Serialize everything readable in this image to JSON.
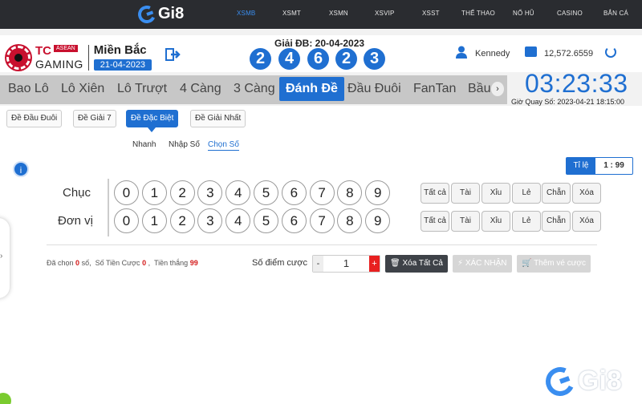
{
  "topnav": {
    "logo": "Gi8",
    "items": [
      "XSMB",
      "XSMT",
      "XSMN",
      "XSVIP",
      "XSST",
      "THỂ THAO",
      "NỔ HŨ",
      "CASINO",
      "BẮN CÁ"
    ],
    "active": "XSMB"
  },
  "header": {
    "brand_tc": "TC",
    "brand_asean": "ASEAN",
    "brand_gaming": "GAMING",
    "region": "Miền Bắc",
    "region_date": "21-04-2023",
    "special_label": "Giải ĐB: 20-04-2023",
    "special_numbers": [
      "2",
      "4",
      "6",
      "2",
      "3"
    ],
    "username": "Kennedy",
    "balance": "12,572.6559",
    "icons": [
      "logout-icon",
      "user-icon",
      "wallet-icon",
      "refresh-icon"
    ]
  },
  "tabs": {
    "items": [
      "Bao Lô",
      "Lô Xiên",
      "Lô Trượt",
      "4 Càng",
      "3 Càng",
      "Đánh Đề",
      "Đầu Đuôi",
      "FanTan",
      "Bầu"
    ],
    "active": "Đánh Đề"
  },
  "clock": {
    "time": "03:23:33",
    "draw_time": "Giờ Quay Số: 2023-04-21 18:15:00"
  },
  "subtabs": {
    "items": [
      "Đề Đầu Đuôi",
      "Đề Giải 7",
      "Đề Đặc Biệt",
      "Đề Giải Nhất"
    ],
    "active": "Đề Đặc Biệt"
  },
  "modes": {
    "items": [
      "Nhanh",
      "Nhập Số",
      "Chọn Số"
    ],
    "active": "Chọn Số"
  },
  "ratio": {
    "label": "Tỉ lệ",
    "value": "1 : 99"
  },
  "picker": {
    "rows": [
      "Chục",
      "Đơn vị"
    ],
    "digits": [
      "0",
      "1",
      "2",
      "3",
      "4",
      "5",
      "6",
      "7",
      "8",
      "9"
    ],
    "quick": [
      "Tất cả",
      "Tài",
      "Xỉu",
      "Lẻ",
      "Chẵn",
      "Xóa"
    ]
  },
  "summary": {
    "chosen_label": "Đã chọn",
    "chosen_value": "0",
    "chosen_unit": "số,",
    "bet_label": "Số Tiền Cược",
    "bet_value": "0",
    "sep": ",",
    "win_label": "Tiền thắng",
    "win_value": "99"
  },
  "bet": {
    "points_label": "Số điểm cược",
    "minus": "-",
    "value": "1",
    "plus": "+",
    "clear_all": "Xóa Tất Cả",
    "confirm": "XÁC NHẬN",
    "add_ticket": "Thêm vé cược"
  },
  "watermark": {
    "text": "Gi8"
  },
  "colors": {
    "primary": "#1f6fd1",
    "nav_bg": "#2a2c30",
    "accent_red": "#d31b1b"
  }
}
